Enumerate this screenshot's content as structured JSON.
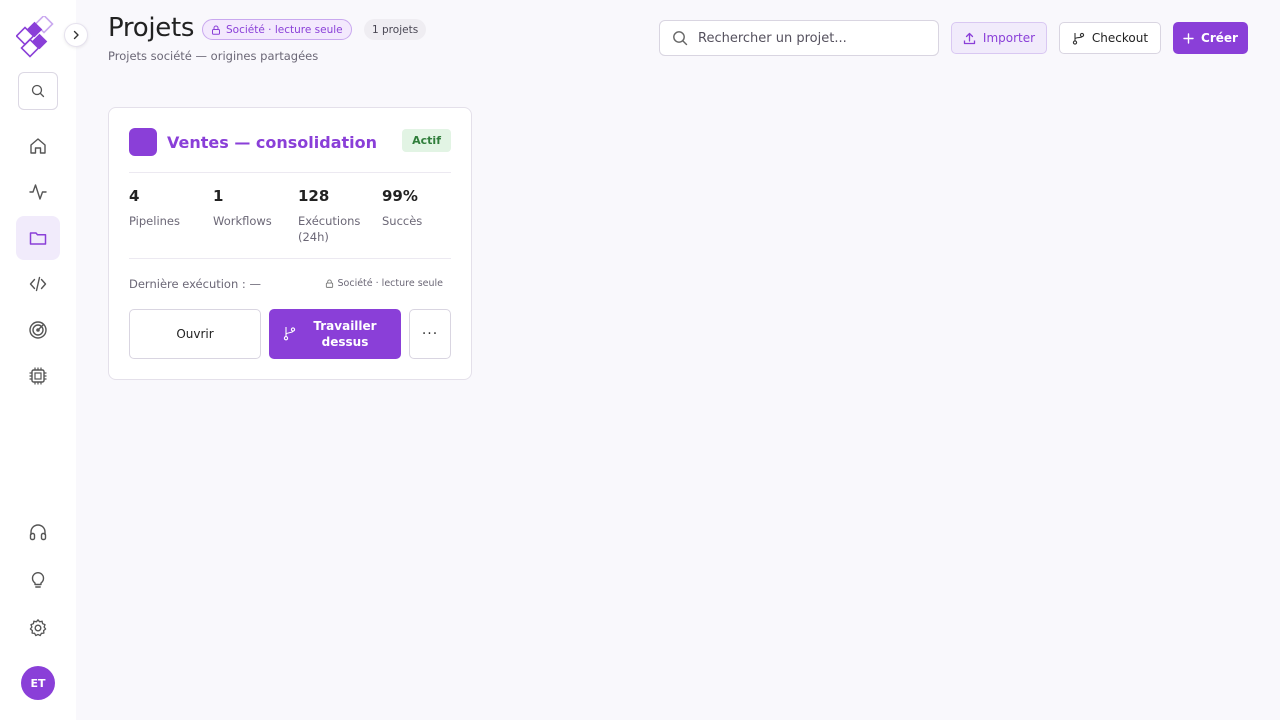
{
  "header": {
    "title": "Projets",
    "scope_badge": "Société · lecture seule",
    "count_badge": "1 projets",
    "subtitle": "Projets société — origines partagées"
  },
  "search": {
    "placeholder": "Rechercher un projet..."
  },
  "toolbar": {
    "import_label": "Importer",
    "checkout_label": "Checkout",
    "create_label": "Créer"
  },
  "sidebar": {
    "items": [
      {
        "name": "home",
        "icon": "home-icon"
      },
      {
        "name": "activity",
        "icon": "activity-icon"
      },
      {
        "name": "projects",
        "icon": "folder-icon",
        "active": true
      },
      {
        "name": "code",
        "icon": "code-icon"
      },
      {
        "name": "target",
        "icon": "target-icon"
      },
      {
        "name": "chip",
        "icon": "chip-icon"
      }
    ],
    "bottom_items": [
      {
        "name": "support",
        "icon": "headphones-icon"
      },
      {
        "name": "ideas",
        "icon": "lightbulb-icon"
      },
      {
        "name": "settings",
        "icon": "gear-icon"
      }
    ],
    "avatar_initials": "ET"
  },
  "card": {
    "name": "Ventes — consolidation",
    "status": "Actif",
    "stats": [
      {
        "value": "4",
        "label": "Pipelines"
      },
      {
        "value": "1",
        "label": "Workflows"
      },
      {
        "value": "128",
        "label": "Exécutions (24h)"
      },
      {
        "value": "99%",
        "label": "Succès"
      }
    ],
    "last_run": "Dernière exécution : —",
    "readonly_tag": "Société · lecture seule",
    "open_label": "Ouvrir",
    "work_label": "Travailler dessus",
    "more_label": "···"
  },
  "colors": {
    "accent": "#8a3fd8",
    "accent_light": "#f1ebfb",
    "success_bg": "#e2f4e4",
    "success_text": "#2f7d3a"
  }
}
